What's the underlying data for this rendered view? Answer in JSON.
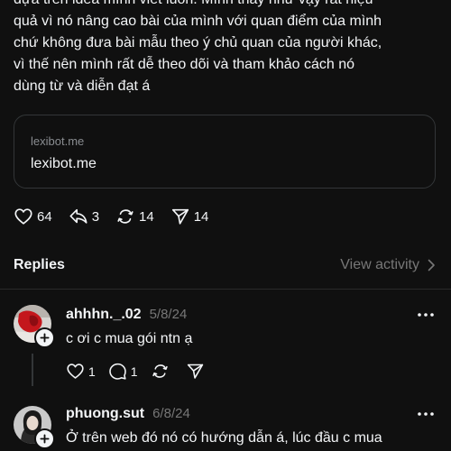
{
  "post": {
    "text_lines": [
      "dựa trên idea mình viết luôn. Mình thấy như vậy rất hiệu",
      "quả vì nó nâng cao bài của mình với quan điểm của mình",
      "chứ không đưa bài mẫu theo ý chủ quan của người khác,",
      "vì thế nên mình rất dễ theo dõi và tham khảo cách nó",
      "dùng từ và diễn đạt á"
    ],
    "link_card": {
      "domain_small": "lexibot.me",
      "domain_big": "lexibot.me"
    },
    "actions": {
      "likes": "64",
      "replies": "3",
      "reposts": "14",
      "shares": "14"
    }
  },
  "replies_section": {
    "title": "Replies",
    "view_activity": "View activity"
  },
  "replies": [
    {
      "username": "ahhhn._.02",
      "date": "5/8/24",
      "text": "c ơi c mua gói ntn ạ",
      "likes": "1",
      "comments": "1"
    },
    {
      "username": "phuong.sut",
      "date": "6/8/24",
      "text": "Ở trên web đó nó có hướng dẫn á, lúc đầu c mua"
    }
  ],
  "colors": {
    "background": "#101010",
    "text": "#f3f5f7",
    "muted": "#777777",
    "border": "#333638"
  }
}
